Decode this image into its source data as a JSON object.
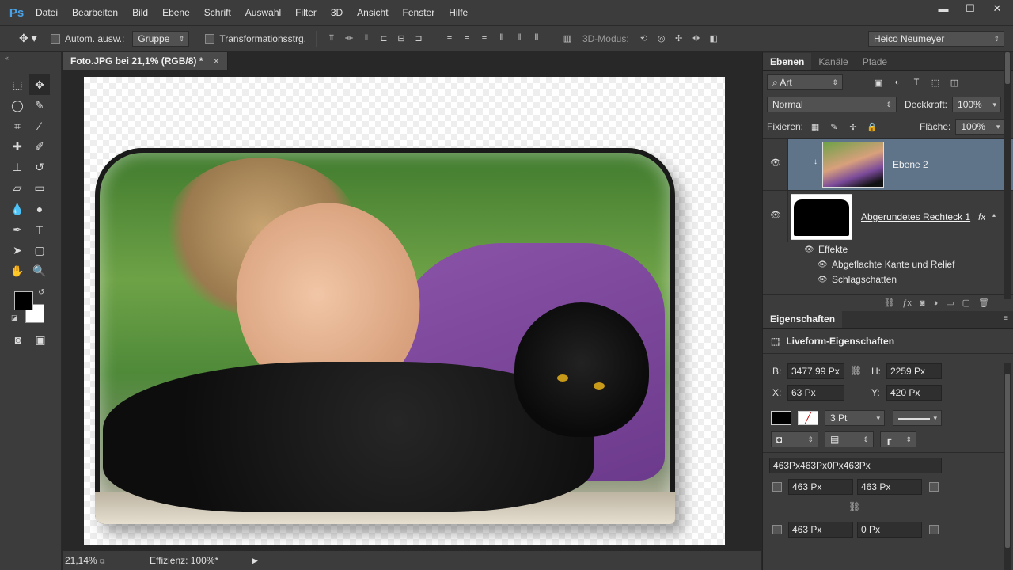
{
  "app": {
    "logo": "Ps"
  },
  "menu": [
    "Datei",
    "Bearbeiten",
    "Bild",
    "Ebene",
    "Schrift",
    "Auswahl",
    "Filter",
    "3D",
    "Ansicht",
    "Fenster",
    "Hilfe"
  ],
  "window_controls": {
    "minimize": "▬",
    "maximize": "☐",
    "close": "✕"
  },
  "options_bar": {
    "auto_select_label": "Autom. ausw.:",
    "auto_select_value": "Gruppe",
    "transform_label": "Transformationsstrg.",
    "mode3d_label": "3D-Modus:",
    "workspace": "Heico Neumeyer"
  },
  "document": {
    "tab_title": "Foto.JPG bei 21,1% (RGB/8) *",
    "close": "×"
  },
  "status_bar": {
    "zoom": "21,14%",
    "efficiency": "Effizienz: 100%*"
  },
  "layers_panel": {
    "tabs": [
      "Ebenen",
      "Kanäle",
      "Pfade"
    ],
    "filter": "Art",
    "blend_mode": "Normal",
    "opacity_label": "Deckkraft:",
    "opacity_value": "100%",
    "lock_label": "Fixieren:",
    "fill_label": "Fläche:",
    "fill_value": "100%",
    "layers": [
      {
        "name": "Ebene 2",
        "selected": true
      },
      {
        "name": "Abgerundetes Rechteck 1",
        "fx": "fx"
      }
    ],
    "effects_label": "Effekte",
    "effects": [
      "Abgeflachte Kante und Relief",
      "Schlagschatten"
    ]
  },
  "properties_panel": {
    "tab": "Eigenschaften",
    "title": "Liveform-Eigenschaften",
    "w_label": "B:",
    "w_value": "3477,99 Px",
    "h_label": "H:",
    "h_value": "2259 Px",
    "x_label": "X:",
    "x_value": "63 Px",
    "y_label": "Y:",
    "y_value": "420 Px",
    "stroke_width": "3 Pt",
    "corner_summary": "463Px463Px0Px463Px",
    "corners": [
      "463 Px",
      "463 Px",
      "463 Px",
      "0 Px"
    ]
  }
}
